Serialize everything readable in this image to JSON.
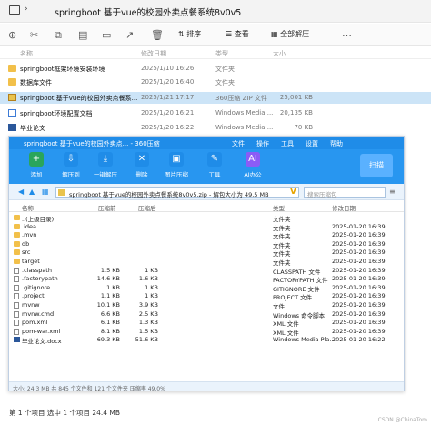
{
  "explorer": {
    "path": "springboot 基于vue的校园外卖点餐系统8v0v5",
    "toolbar": {
      "sort": "排序",
      "view": "查看",
      "select_all": "全部解压"
    },
    "headers": {
      "name": "名称",
      "date": "修改日期",
      "type": "类型",
      "size": "大小"
    },
    "rows": [
      {
        "name": "springboot框架环境安装环境",
        "date": "2025/1/10 16:26",
        "type": "文件夹",
        "size": "",
        "kind": "folder"
      },
      {
        "name": "数据库文件",
        "date": "2025/1/20 16:40",
        "type": "文件夹",
        "size": "",
        "kind": "folder"
      },
      {
        "name": "springboot 基于vue的校园外卖点餐系...",
        "date": "2025/1/21 17:17",
        "type": "360压缩 ZIP 文件",
        "size": "25,001 KB",
        "kind": "zip",
        "selected": true
      },
      {
        "name": "springboot环境配置文档",
        "date": "2025/1/20 16:21",
        "type": "Windows Media ...",
        "size": "20,135 KB",
        "kind": "video"
      },
      {
        "name": "毕业论文",
        "date": "2025/1/20 16:22",
        "type": "Windows Media ...",
        "size": "70 KB",
        "kind": "doc"
      }
    ],
    "status": "第 1 个项目  选中 1 个项目  24.4 MB"
  },
  "zip": {
    "title": "springboot 基于vue的校园外卖点... - 360压缩",
    "menu": [
      "文件",
      "操作",
      "工具",
      "设置",
      "帮助"
    ],
    "tools": [
      {
        "label": "添加",
        "glyph": "+",
        "color": "#2aa55b"
      },
      {
        "label": "解压到",
        "glyph": "⇩",
        "color": "#1f8ce8"
      },
      {
        "label": "一键解压",
        "glyph": "⤓",
        "color": "#1f8ce8"
      },
      {
        "label": "删除",
        "glyph": "✕",
        "color": "#1f8ce8"
      },
      {
        "label": "图片压缩",
        "glyph": "▣",
        "color": "#1f8ce8"
      },
      {
        "label": "工具",
        "glyph": "✎",
        "color": "#1f8ce8"
      },
      {
        "label": "AI办公",
        "glyph": "AI",
        "color": "#8b5cf6"
      }
    ],
    "scan": "扫描",
    "address": "springboot 基于vue的校园外卖点餐系统8v0v5.zip - 解包大小为 49.5 MB",
    "search_placeholder": "搜索压缩包",
    "headers": {
      "name": "名称",
      "packed": "压缩前",
      "unpacked": "压缩后",
      "type": "类型",
      "date": "修改日期"
    },
    "rows": [
      {
        "name": "..(上级目录)",
        "packed": "",
        "unpacked": "",
        "type": "文件夹",
        "date": "",
        "kind": "folder"
      },
      {
        "name": ".idea",
        "packed": "",
        "unpacked": "",
        "type": "文件夹",
        "date": "2025-01-20 16:39",
        "kind": "folder"
      },
      {
        "name": ".mvn",
        "packed": "",
        "unpacked": "",
        "type": "文件夹",
        "date": "2025-01-20 16:39",
        "kind": "folder"
      },
      {
        "name": "db",
        "packed": "",
        "unpacked": "",
        "type": "文件夹",
        "date": "2025-01-20 16:39",
        "kind": "folder"
      },
      {
        "name": "src",
        "packed": "",
        "unpacked": "",
        "type": "文件夹",
        "date": "2025-01-20 16:39",
        "kind": "folder"
      },
      {
        "name": "target",
        "packed": "",
        "unpacked": "",
        "type": "文件夹",
        "date": "2025-01-20 16:39",
        "kind": "folder"
      },
      {
        "name": ".classpath",
        "packed": "1.5 KB",
        "unpacked": "1 KB",
        "type": "CLASSPATH 文件",
        "date": "2025-01-20 16:39",
        "kind": "file"
      },
      {
        "name": ".factorypath",
        "packed": "14.6 KB",
        "unpacked": "1.6 KB",
        "type": "FACTORYPATH 文件",
        "date": "2025-01-20 16:39",
        "kind": "file"
      },
      {
        "name": ".gitignore",
        "packed": "1 KB",
        "unpacked": "1 KB",
        "type": "GITIGNORE 文件",
        "date": "2025-01-20 16:39",
        "kind": "file"
      },
      {
        "name": ".project",
        "packed": "1.1 KB",
        "unpacked": "1 KB",
        "type": "PROJECT 文件",
        "date": "2025-01-20 16:39",
        "kind": "file"
      },
      {
        "name": "mvnw",
        "packed": "10.1 KB",
        "unpacked": "3.9 KB",
        "type": "文件",
        "date": "2025-01-20 16:39",
        "kind": "file"
      },
      {
        "name": "mvnw.cmd",
        "packed": "6.6 KB",
        "unpacked": "2.5 KB",
        "type": "Windows 命令脚本",
        "date": "2025-01-20 16:39",
        "kind": "file"
      },
      {
        "name": "pom.xml",
        "packed": "6.1 KB",
        "unpacked": "1.3 KB",
        "type": "XML 文件",
        "date": "2025-01-20 16:39",
        "kind": "file"
      },
      {
        "name": "pom-war.xml",
        "packed": "8.1 KB",
        "unpacked": "1.5 KB",
        "type": "XML 文件",
        "date": "2025-01-20 16:39",
        "kind": "file"
      },
      {
        "name": "毕业论文.docx",
        "packed": "69.3 KB",
        "unpacked": "51.6 KB",
        "type": "Windows Media Pla...",
        "date": "2025-01-20 16:22",
        "kind": "doc"
      }
    ],
    "status": "大小: 24.3 MB 共 845 个文件和 121 个文件夹 压缩率 49.0%"
  },
  "watermark": "CSDN @ChinaTom"
}
